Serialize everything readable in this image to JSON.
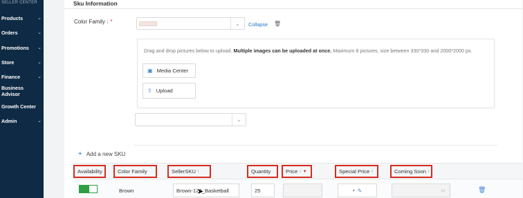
{
  "sidebar": {
    "brand": "SELLER CENTER",
    "items": [
      {
        "label": "Products",
        "chevron": true
      },
      {
        "label": "Orders",
        "chevron": true
      },
      {
        "label": "Promotions",
        "chevron": true
      },
      {
        "label": "Store",
        "chevron": true
      },
      {
        "label": "Finance",
        "chevron": true
      },
      {
        "label": "Business Advisor",
        "chevron": false
      },
      {
        "label": "Growth Center",
        "chevron": false
      },
      {
        "label": "Admin",
        "chevron": true
      }
    ]
  },
  "section": {
    "title": "Sku Information"
  },
  "color_family": {
    "label": "Color Family",
    "info": "i",
    "required": "*",
    "collapse": "Collapse"
  },
  "upload": {
    "hint_prefix": "Drag and drop pictures below to upload.",
    "hint_bold": "Multiple images can be uploaded at once.",
    "hint_suffix": "Maximum 8 pictures, size between 330*330 and 2000*2000 px.",
    "media_center": "Media Center",
    "upload": "Upload"
  },
  "add_sku": "Add a new SKU",
  "table": {
    "headers": {
      "availability": "Availability",
      "color_family": "Color Family",
      "seller_sku": "SellerSKU",
      "quantity": "Quantity",
      "price": "Price",
      "special_price": "Special Price",
      "coming_soon": "Coming Soon"
    },
    "info_glyph": "i",
    "row": {
      "availability_on": true,
      "color_family": "Brown",
      "seller_sku": "Brown-123_Basketball",
      "quantity": "25"
    }
  },
  "colors": {
    "sidebar_bg": "#0f2a44",
    "highlight_red": "#d42b1e",
    "link_blue": "#1a73c8",
    "toggle_green": "#2ea043"
  }
}
